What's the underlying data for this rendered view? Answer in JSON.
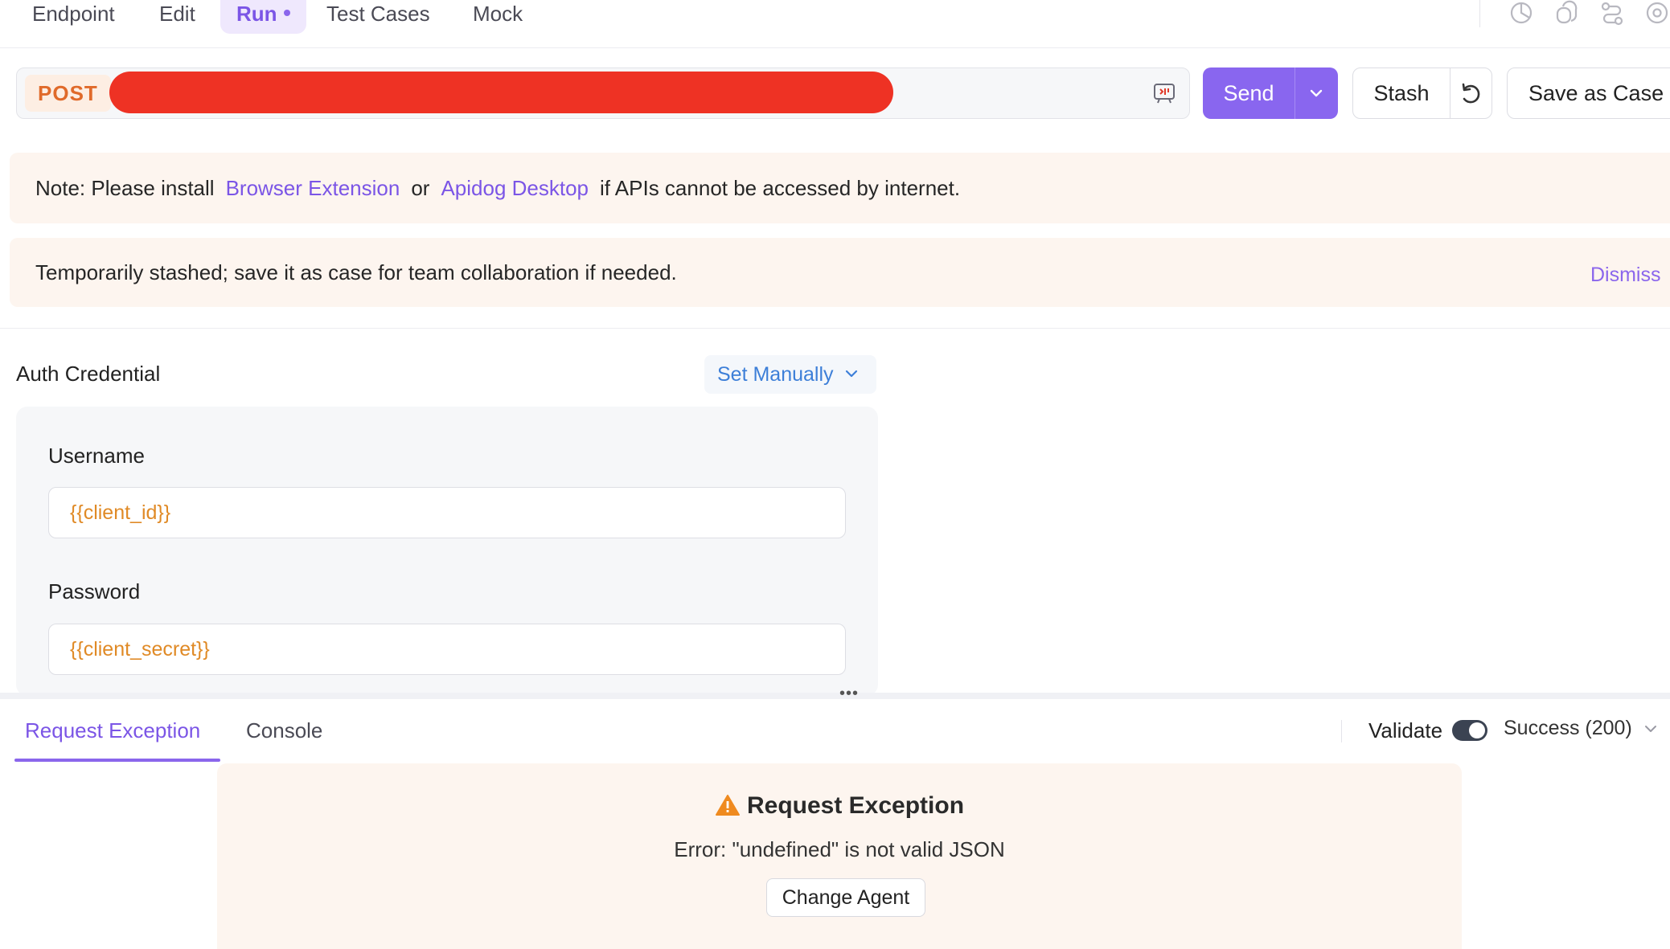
{
  "top_tabs": [
    {
      "label": "Endpoint"
    },
    {
      "label": "Edit"
    },
    {
      "label": "Run"
    },
    {
      "label": "Test Cases"
    },
    {
      "label": "Mock"
    }
  ],
  "active_tab": "Run",
  "toolbar_icons": [
    "chart-pie-icon",
    "copy-icon",
    "flow-icon",
    "settings-icon"
  ],
  "request": {
    "method": "POST",
    "url": "",
    "send_label": "Send",
    "stash_label": "Stash",
    "save_case_label": "Save as Case"
  },
  "notices": {
    "install": {
      "prefix": "Note: Please install",
      "link1": "Browser Extension",
      "or": "or",
      "link2": "Apidog Desktop",
      "suffix": "if APIs cannot be accessed by internet."
    },
    "stashed": {
      "text": "Temporarily stashed; save it as case for team collaboration if needed.",
      "dismiss": "Dismiss"
    }
  },
  "auth": {
    "title": "Auth Credential",
    "mode": "Set Manually",
    "username_label": "Username",
    "username_value": "{{client_id}}",
    "password_label": "Password",
    "password_value": "{{client_secret}}"
  },
  "bottom_tabs": {
    "request_exception": "Request Exception",
    "console": "Console"
  },
  "response": {
    "validate_label": "Validate",
    "validate_on": true,
    "status": "Success (200)"
  },
  "exception": {
    "title": "Request Exception",
    "message": "Error: \"undefined\" is not valid JSON",
    "button": "Change Agent"
  },
  "colors": {
    "accent": "#8966ef",
    "method": "#e06a2a",
    "notice_bg": "#fdf5ef",
    "variable": "#e08a26",
    "redaction": "#ee3224"
  }
}
